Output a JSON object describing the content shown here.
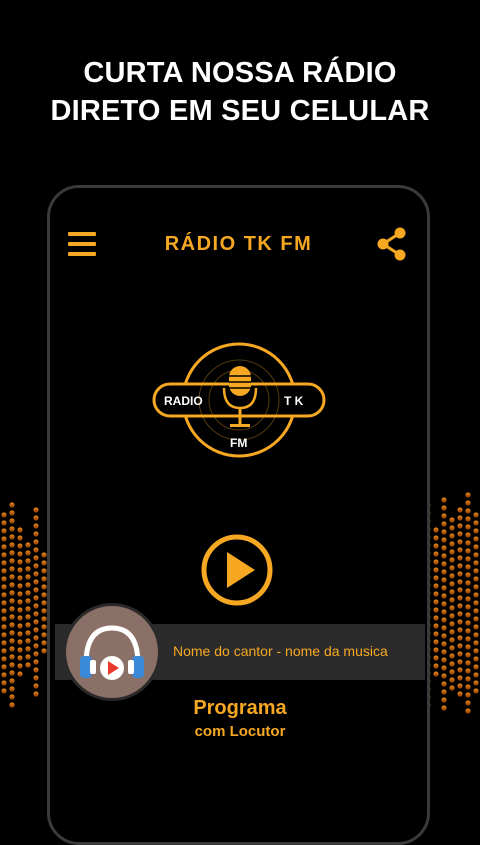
{
  "promo": {
    "line1": "CURTA NOSSA RÁDIO",
    "line2": "DIRETO EM SEU CELULAR"
  },
  "app_bar": {
    "title": "RÁDIO TK FM",
    "menu_icon": "hamburger-menu-icon",
    "share_icon": "share-icon"
  },
  "logo": {
    "left_text": "RADIO",
    "right_text": "T K",
    "bottom_text": "FM",
    "icon": "microphone-icon"
  },
  "player": {
    "play_icon": "play-icon",
    "track_info": "Nome do cantor - nome da musica",
    "avatar_icon": "headphones-icon"
  },
  "program": {
    "name": "Programa",
    "host": "com Locutor"
  },
  "colors": {
    "accent": "#f6a823",
    "background": "#000000",
    "equalizer_top": "#f08a1a",
    "equalizer_bottom": "#8a3b00"
  }
}
